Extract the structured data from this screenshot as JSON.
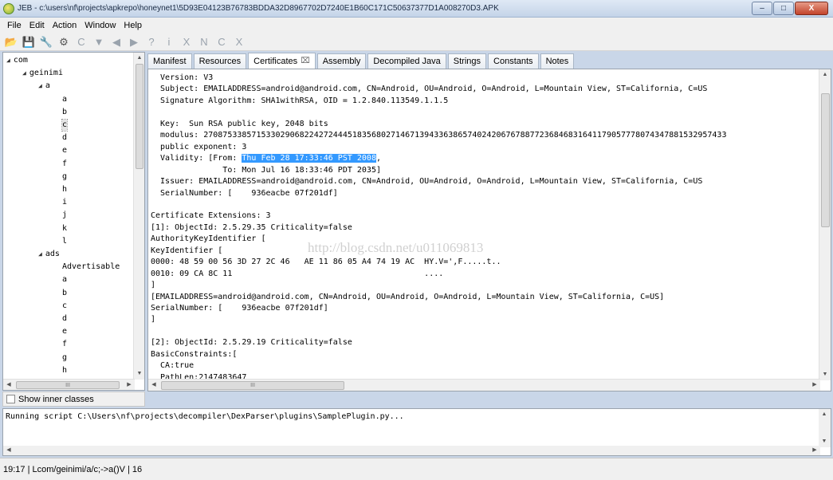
{
  "window": {
    "title": "JEB - c:\\users\\nf\\projects\\apkrepo\\honeynet1\\5D93E04123B76783BDDA32D8967702D7240E1B60C171C50637377D1A008270D3.APK",
    "controls": [
      "–",
      "□",
      "X"
    ]
  },
  "menu": [
    "File",
    "Edit",
    "Action",
    "Window",
    "Help"
  ],
  "toolbar": [
    {
      "name": "open-icon",
      "glyph": "📂",
      "color": "#d9a21b"
    },
    {
      "name": "save-icon",
      "glyph": "💾",
      "color": "#3b6db3"
    },
    {
      "name": "wrench-icon",
      "glyph": "🔧",
      "color": "#7a6a3a"
    },
    {
      "name": "settings-icon",
      "glyph": "⚙",
      "color": "#555"
    },
    {
      "name": "refresh-icon",
      "glyph": "C",
      "color": "#9aa3ad"
    },
    {
      "name": "filter-icon",
      "glyph": "▼",
      "color": "#9aa3ad"
    },
    {
      "name": "back-icon",
      "glyph": "◀",
      "color": "#9aa3ad"
    },
    {
      "name": "forward-icon",
      "glyph": "▶",
      "color": "#9aa3ad"
    },
    {
      "name": "help-icon",
      "glyph": "?",
      "color": "#9aa3ad"
    },
    {
      "name": "info-icon",
      "glyph": "i",
      "color": "#9aa3ad"
    },
    {
      "name": "cross-ref-icon",
      "glyph": "X",
      "color": "#9aa3ad"
    },
    {
      "name": "rename-icon",
      "glyph": "N",
      "color": "#9aa3ad"
    },
    {
      "name": "comment-icon",
      "glyph": "C",
      "color": "#9aa3ad"
    },
    {
      "name": "delete-icon",
      "glyph": "X",
      "color": "#9aa3ad"
    }
  ],
  "tree": {
    "items": [
      {
        "label": "com",
        "depth": 0,
        "expandable": true
      },
      {
        "label": "geinimi",
        "depth": 1,
        "expandable": true
      },
      {
        "label": "a",
        "depth": 2,
        "expandable": true
      },
      {
        "label": "a",
        "depth": 3
      },
      {
        "label": "b",
        "depth": 3
      },
      {
        "label": "c",
        "depth": 3,
        "selected": true
      },
      {
        "label": "d",
        "depth": 3
      },
      {
        "label": "e",
        "depth": 3
      },
      {
        "label": "f",
        "depth": 3
      },
      {
        "label": "g",
        "depth": 3
      },
      {
        "label": "h",
        "depth": 3
      },
      {
        "label": "i",
        "depth": 3
      },
      {
        "label": "j",
        "depth": 3
      },
      {
        "label": "k",
        "depth": 3
      },
      {
        "label": "l",
        "depth": 3
      },
      {
        "label": "ads",
        "depth": 2,
        "expandable": true
      },
      {
        "label": "Advertisable",
        "depth": 3
      },
      {
        "label": "a",
        "depth": 3
      },
      {
        "label": "b",
        "depth": 3
      },
      {
        "label": "c",
        "depth": 3
      },
      {
        "label": "d",
        "depth": 3
      },
      {
        "label": "e",
        "depth": 3
      },
      {
        "label": "f",
        "depth": 3
      },
      {
        "label": "g",
        "depth": 3
      },
      {
        "label": "h",
        "depth": 3
      }
    ],
    "scroll_h_thumb": "III",
    "show_inner_classes": "Show inner classes"
  },
  "tabs": [
    {
      "label": "Manifest"
    },
    {
      "label": "Resources"
    },
    {
      "label": "Certificates",
      "active": true,
      "close": "⌧"
    },
    {
      "label": "Assembly"
    },
    {
      "label": "Decompiled Java"
    },
    {
      "label": "Strings"
    },
    {
      "label": "Constants"
    },
    {
      "label": "Notes"
    }
  ],
  "editor": {
    "lines": [
      "  Version: V3",
      "  Subject: EMAILADDRESS=android@android.com, CN=Android, OU=Android, O=Android, L=Mountain View, ST=California, C=US",
      "  Signature Algorithm: SHA1withRSA, OID = 1.2.840.113549.1.1.5",
      "",
      "  Key:  Sun RSA public key, 2048 bits",
      "  modulus: 2708753385715330290682242724445183568027146713943363865740242067678877236846831641179057778074347881532957433",
      "  public exponent: 3",
      "  Validity: [From: |Thu Feb 28 17:33:46 PST 2008|,",
      "               To: Mon Jul 16 18:33:46 PDT 2035]",
      "  Issuer: EMAILADDRESS=android@android.com, CN=Android, OU=Android, O=Android, L=Mountain View, ST=California, C=US",
      "  SerialNumber: [    936eacbe 07f201df]",
      "",
      "Certificate Extensions: 3",
      "[1]: ObjectId: 2.5.29.35 Criticality=false",
      "AuthorityKeyIdentifier [",
      "KeyIdentifier [",
      "0000: 48 59 00 56 3D 27 2C 46   AE 11 86 05 A4 74 19 AC  HY.V=',F.....t..",
      "0010: 09 CA 8C 11                                        ....",
      "]",
      "[EMAILADDRESS=android@android.com, CN=Android, OU=Android, O=Android, L=Mountain View, ST=California, C=US]",
      "SerialNumber: [    936eacbe 07f201df]",
      "]",
      "",
      "[2]: ObjectId: 2.5.29.19 Criticality=false",
      "BasicConstraints:[",
      "  CA:true",
      "  PathLen:2147483647"
    ],
    "watermark": "http://blog.csdn.net/u011069813",
    "scroll_h_thumb": "III"
  },
  "console": {
    "line": "Running script C:\\Users\\nf\\projects\\decompiler\\DexParser\\plugins\\SamplePlugin.py..."
  },
  "status": "19:17 | Lcom/geinimi/a/c;->a()V | 16"
}
